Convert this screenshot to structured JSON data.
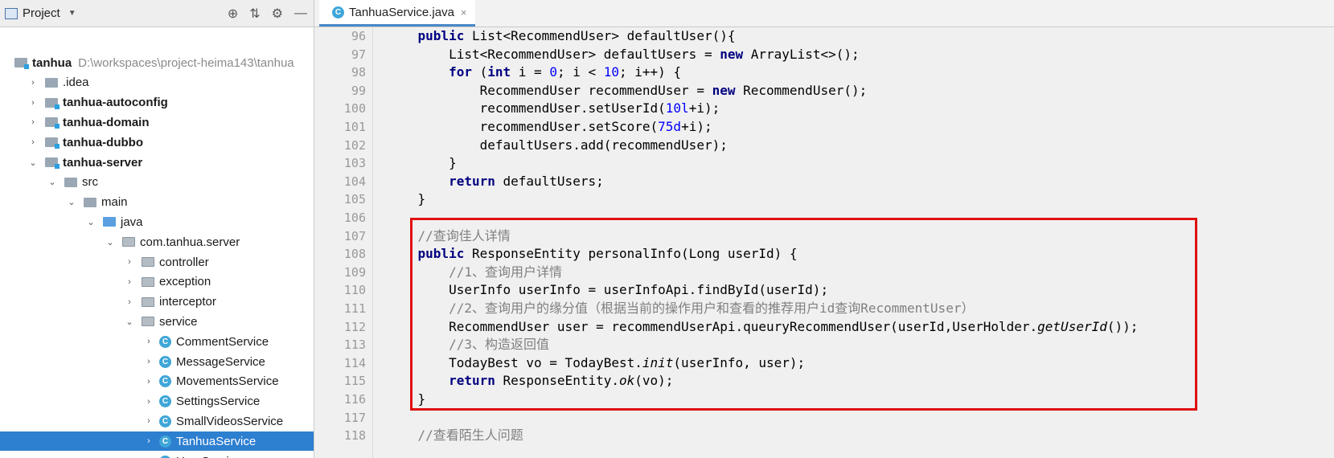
{
  "project_panel": {
    "title": "Project",
    "toolbar_icons": [
      "locate-icon",
      "collapse-icon",
      "gear-icon",
      "minimize-icon"
    ],
    "tree": [
      {
        "label": "tanhua",
        "extra": "D:\\workspaces\\project-heima143\\tanhua",
        "depth": 0,
        "kind": "root",
        "expanded": true,
        "bold": true
      },
      {
        "label": ".idea",
        "depth": 1,
        "kind": "folder",
        "expanded": false
      },
      {
        "label": "tanhua-autoconfig",
        "depth": 1,
        "kind": "module",
        "expanded": false,
        "bold": true
      },
      {
        "label": "tanhua-domain",
        "depth": 1,
        "kind": "module",
        "expanded": false,
        "bold": true
      },
      {
        "label": "tanhua-dubbo",
        "depth": 1,
        "kind": "module",
        "expanded": false,
        "bold": true
      },
      {
        "label": "tanhua-server",
        "depth": 1,
        "kind": "module",
        "expanded": true,
        "bold": true
      },
      {
        "label": "src",
        "depth": 2,
        "kind": "folder",
        "expanded": true
      },
      {
        "label": "main",
        "depth": 3,
        "kind": "folder",
        "expanded": true
      },
      {
        "label": "java",
        "depth": 4,
        "kind": "source",
        "expanded": true
      },
      {
        "label": "com.tanhua.server",
        "depth": 5,
        "kind": "package",
        "expanded": true
      },
      {
        "label": "controller",
        "depth": 6,
        "kind": "package",
        "expanded": false
      },
      {
        "label": "exception",
        "depth": 6,
        "kind": "package",
        "expanded": false
      },
      {
        "label": "interceptor",
        "depth": 6,
        "kind": "package",
        "expanded": false
      },
      {
        "label": "service",
        "depth": 6,
        "kind": "package",
        "expanded": true
      },
      {
        "label": "CommentService",
        "depth": 7,
        "kind": "class",
        "expanded": false
      },
      {
        "label": "MessageService",
        "depth": 7,
        "kind": "class",
        "expanded": false
      },
      {
        "label": "MovementsService",
        "depth": 7,
        "kind": "class",
        "expanded": false
      },
      {
        "label": "SettingsService",
        "depth": 7,
        "kind": "class",
        "expanded": false
      },
      {
        "label": "SmallVideosService",
        "depth": 7,
        "kind": "class",
        "expanded": false
      },
      {
        "label": "TanhuaService",
        "depth": 7,
        "kind": "class",
        "expanded": false,
        "selected": true
      },
      {
        "label": "UserService",
        "depth": 7,
        "kind": "class",
        "expanded": false
      }
    ]
  },
  "editor": {
    "tab_label": "TanhuaService.java",
    "tab_close": "×",
    "class_badge": "C",
    "lines": [
      {
        "n": "96",
        "text": "    public List<RecommendUser> defaultUser(){"
      },
      {
        "n": "97",
        "text": "        List<RecommendUser> defaultUsers = new ArrayList<>();"
      },
      {
        "n": "98",
        "text": "        for (int i = 0; i < 10; i++) {"
      },
      {
        "n": "99",
        "text": "            RecommendUser recommendUser = new RecommendUser();"
      },
      {
        "n": "100",
        "text": "            recommendUser.setUserId(10l+i);"
      },
      {
        "n": "101",
        "text": "            recommendUser.setScore(75d+i);"
      },
      {
        "n": "102",
        "text": "            defaultUsers.add(recommendUser);"
      },
      {
        "n": "103",
        "text": "        }"
      },
      {
        "n": "104",
        "text": "        return defaultUsers;"
      },
      {
        "n": "105",
        "text": "    }"
      },
      {
        "n": "106",
        "text": ""
      },
      {
        "n": "107",
        "text": "    //查询佳人详情"
      },
      {
        "n": "108",
        "text": "    public ResponseEntity personalInfo(Long userId) {"
      },
      {
        "n": "109",
        "text": "        //1、查询用户详情"
      },
      {
        "n": "110",
        "text": "        UserInfo userInfo = userInfoApi.findById(userId);"
      },
      {
        "n": "111",
        "text": "        //2、查询用户的缘分值（根据当前的操作用户和查看的推荐用户id查询RecommentUser）"
      },
      {
        "n": "112",
        "text": "        RecommendUser user = recommendUserApi.queuryRecommendUser(userId,UserHolder.getUserId());"
      },
      {
        "n": "113",
        "text": "        //3、构造返回值"
      },
      {
        "n": "114",
        "text": "        TodayBest vo = TodayBest.init(userInfo, user);"
      },
      {
        "n": "115",
        "text": "        return ResponseEntity.ok(vo);"
      },
      {
        "n": "116",
        "text": "    }"
      },
      {
        "n": "117",
        "text": ""
      },
      {
        "n": "118",
        "text": "    //查看陌生人问题"
      }
    ]
  },
  "colors": {
    "selection": "#2d7fd0",
    "highlight_box": "#e01010",
    "keyword": "#000080",
    "comment": "#808080",
    "number": "#0000ff"
  }
}
